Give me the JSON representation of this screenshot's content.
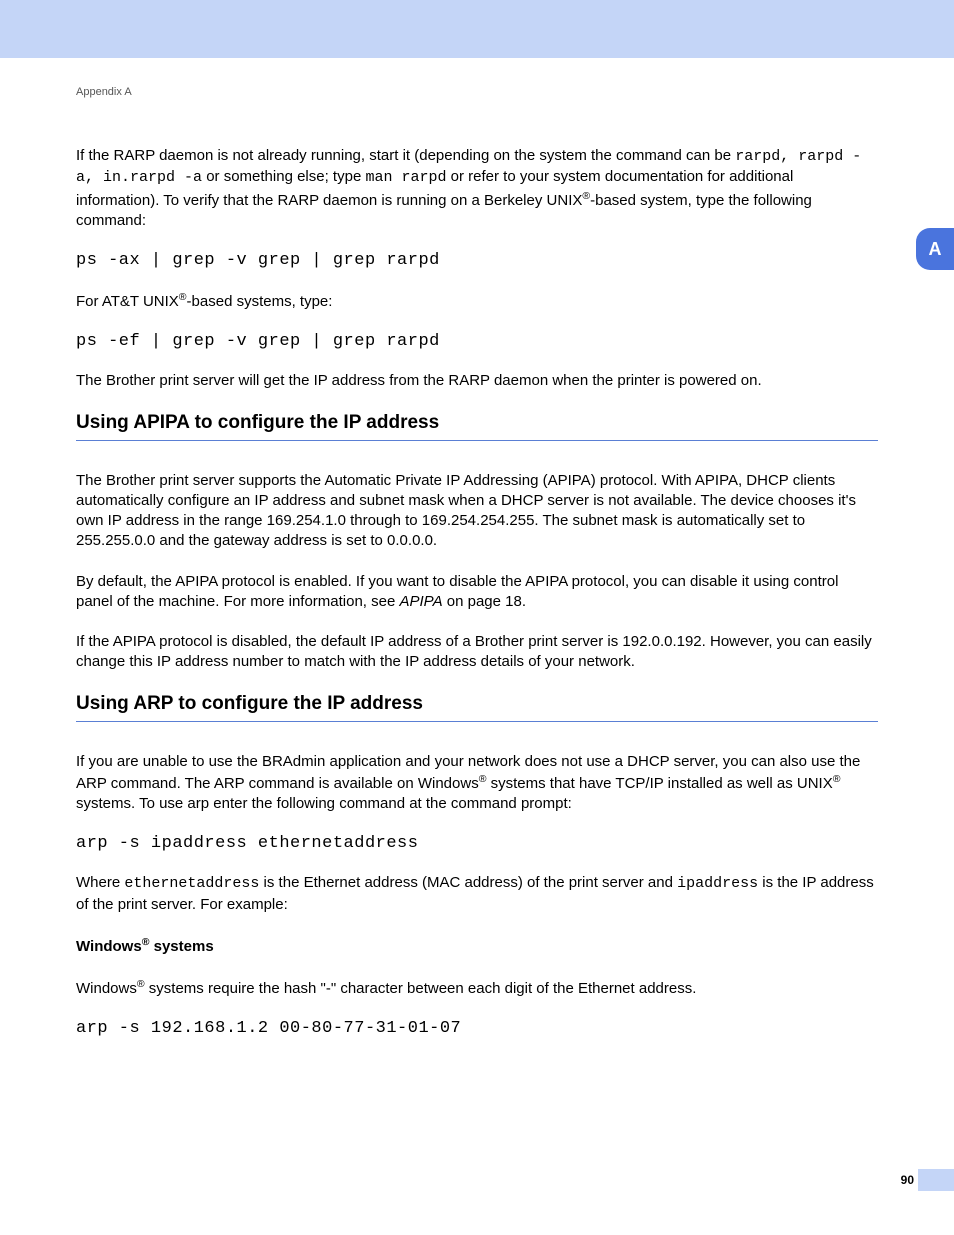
{
  "header": {
    "appendix": "Appendix A"
  },
  "sideTab": "A",
  "pageNumber": "90",
  "intro": {
    "p1_a": "If the RARP daemon is not already running, start it (depending on the system the command can be ",
    "p1_b": "rarpd, rarpd -a, in.rarpd -a",
    "p1_c": " or something else; type ",
    "p1_d": "man rarpd",
    "p1_e": " or refer to your system documentation for additional information). To verify that the RARP daemon is running on a Berkeley UNIX",
    "p1_f": "-based system, type the following command:",
    "cmd1": "ps -ax | grep -v grep | grep rarpd",
    "p2_a": "For AT&T UNIX",
    "p2_b": "-based systems, type:",
    "cmd2": "ps -ef | grep -v grep | grep rarpd",
    "p3": "The Brother print server will get the IP address from the RARP daemon when the printer is powered on."
  },
  "apipa": {
    "heading": "Using APIPA to configure the IP address",
    "p1": "The Brother print server supports the Automatic Private IP Addressing (APIPA) protocol. With APIPA, DHCP clients automatically configure an IP address and subnet mask when a DHCP server is not available. The device chooses it's own IP address in the range 169.254.1.0 through to 169.254.254.255. The subnet mask is automatically set to 255.255.0.0 and the gateway address is set to 0.0.0.0.",
    "p2_a": "By default, the APIPA protocol is enabled. If you want to disable the APIPA protocol, you can disable it using control panel of the machine. For more information, see ",
    "p2_link": "APIPA",
    "p2_b": " on page 18.",
    "p3": "If the APIPA protocol is disabled, the default IP address of a Brother print server is 192.0.0.192. However, you can easily change this IP address number to match with the IP address details of your network."
  },
  "arp": {
    "heading": "Using ARP to configure the IP address",
    "p1_a": "If you are unable to use the BRAdmin application and your network does not use a DHCP server, you can also use the ARP command. The ARP command is available on Windows",
    "p1_b": " systems that have TCP/IP installed as well as UNIX",
    "p1_c": " systems. To use arp enter the following command at the command prompt:",
    "cmd1": "arp -s ipaddress ethernetaddress",
    "p2_a": "Where ",
    "p2_b": "ethernetaddress",
    "p2_c": " is the Ethernet address (MAC address) of the print server and ",
    "p2_d": "ipaddress",
    "p2_e": " is the IP address of the print server. For example:",
    "subheading_a": "Windows",
    "subheading_b": " systems",
    "p3_a": "Windows",
    "p3_b": " systems require the hash \"-\" character between each digit of the Ethernet address.",
    "cmd2": "arp -s 192.168.1.2 00-80-77-31-01-07"
  }
}
